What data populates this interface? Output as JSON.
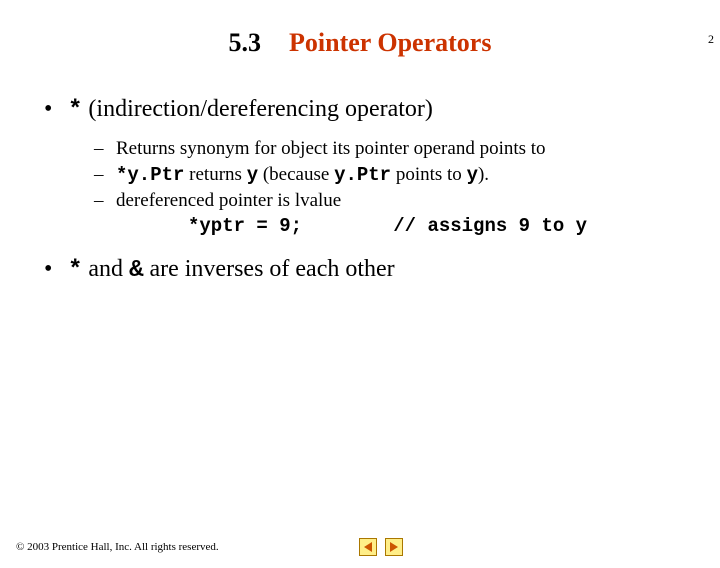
{
  "page_number": "2",
  "header": {
    "section_number": "5.3",
    "section_title": "Pointer Operators"
  },
  "bullets": [
    {
      "symbol": "*",
      "text": "(indirection/dereferencing operator)"
    },
    {
      "symbol": "*",
      "mid": "and",
      "symbol2": "&",
      "text": "are inverses of each other"
    }
  ],
  "subitems": {
    "s1": "Returns synonym for object its pointer operand points to",
    "s2_a": "*y.Ptr",
    "s2_b": "returns",
    "s2_c": "y",
    "s2_d": "(because",
    "s2_e": "y.Ptr",
    "s2_f": "points to",
    "s2_g": "y",
    "s2_h": ").",
    "s3": "dereferenced pointer is lvalue"
  },
  "code": "*yptr = 9;        // assigns 9 to y",
  "footer": {
    "copyright": "© 2003 Prentice Hall, Inc.  All rights reserved."
  }
}
